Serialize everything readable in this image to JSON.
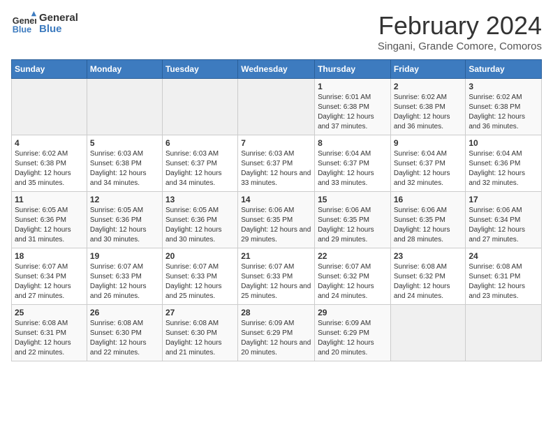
{
  "header": {
    "logo_line1": "General",
    "logo_line2": "Blue",
    "month_title": "February 2024",
    "subtitle": "Singani, Grande Comore, Comoros"
  },
  "days_of_week": [
    "Sunday",
    "Monday",
    "Tuesday",
    "Wednesday",
    "Thursday",
    "Friday",
    "Saturday"
  ],
  "weeks": [
    [
      {
        "day": "",
        "info": ""
      },
      {
        "day": "",
        "info": ""
      },
      {
        "day": "",
        "info": ""
      },
      {
        "day": "",
        "info": ""
      },
      {
        "day": "1",
        "info": "Sunrise: 6:01 AM\nSunset: 6:38 PM\nDaylight: 12 hours and 37 minutes."
      },
      {
        "day": "2",
        "info": "Sunrise: 6:02 AM\nSunset: 6:38 PM\nDaylight: 12 hours and 36 minutes."
      },
      {
        "day": "3",
        "info": "Sunrise: 6:02 AM\nSunset: 6:38 PM\nDaylight: 12 hours and 36 minutes."
      }
    ],
    [
      {
        "day": "4",
        "info": "Sunrise: 6:02 AM\nSunset: 6:38 PM\nDaylight: 12 hours and 35 minutes."
      },
      {
        "day": "5",
        "info": "Sunrise: 6:03 AM\nSunset: 6:38 PM\nDaylight: 12 hours and 34 minutes."
      },
      {
        "day": "6",
        "info": "Sunrise: 6:03 AM\nSunset: 6:37 PM\nDaylight: 12 hours and 34 minutes."
      },
      {
        "day": "7",
        "info": "Sunrise: 6:03 AM\nSunset: 6:37 PM\nDaylight: 12 hours and 33 minutes."
      },
      {
        "day": "8",
        "info": "Sunrise: 6:04 AM\nSunset: 6:37 PM\nDaylight: 12 hours and 33 minutes."
      },
      {
        "day": "9",
        "info": "Sunrise: 6:04 AM\nSunset: 6:37 PM\nDaylight: 12 hours and 32 minutes."
      },
      {
        "day": "10",
        "info": "Sunrise: 6:04 AM\nSunset: 6:36 PM\nDaylight: 12 hours and 32 minutes."
      }
    ],
    [
      {
        "day": "11",
        "info": "Sunrise: 6:05 AM\nSunset: 6:36 PM\nDaylight: 12 hours and 31 minutes."
      },
      {
        "day": "12",
        "info": "Sunrise: 6:05 AM\nSunset: 6:36 PM\nDaylight: 12 hours and 30 minutes."
      },
      {
        "day": "13",
        "info": "Sunrise: 6:05 AM\nSunset: 6:36 PM\nDaylight: 12 hours and 30 minutes."
      },
      {
        "day": "14",
        "info": "Sunrise: 6:06 AM\nSunset: 6:35 PM\nDaylight: 12 hours and 29 minutes."
      },
      {
        "day": "15",
        "info": "Sunrise: 6:06 AM\nSunset: 6:35 PM\nDaylight: 12 hours and 29 minutes."
      },
      {
        "day": "16",
        "info": "Sunrise: 6:06 AM\nSunset: 6:35 PM\nDaylight: 12 hours and 28 minutes."
      },
      {
        "day": "17",
        "info": "Sunrise: 6:06 AM\nSunset: 6:34 PM\nDaylight: 12 hours and 27 minutes."
      }
    ],
    [
      {
        "day": "18",
        "info": "Sunrise: 6:07 AM\nSunset: 6:34 PM\nDaylight: 12 hours and 27 minutes."
      },
      {
        "day": "19",
        "info": "Sunrise: 6:07 AM\nSunset: 6:33 PM\nDaylight: 12 hours and 26 minutes."
      },
      {
        "day": "20",
        "info": "Sunrise: 6:07 AM\nSunset: 6:33 PM\nDaylight: 12 hours and 25 minutes."
      },
      {
        "day": "21",
        "info": "Sunrise: 6:07 AM\nSunset: 6:33 PM\nDaylight: 12 hours and 25 minutes."
      },
      {
        "day": "22",
        "info": "Sunrise: 6:07 AM\nSunset: 6:32 PM\nDaylight: 12 hours and 24 minutes."
      },
      {
        "day": "23",
        "info": "Sunrise: 6:08 AM\nSunset: 6:32 PM\nDaylight: 12 hours and 24 minutes."
      },
      {
        "day": "24",
        "info": "Sunrise: 6:08 AM\nSunset: 6:31 PM\nDaylight: 12 hours and 23 minutes."
      }
    ],
    [
      {
        "day": "25",
        "info": "Sunrise: 6:08 AM\nSunset: 6:31 PM\nDaylight: 12 hours and 22 minutes."
      },
      {
        "day": "26",
        "info": "Sunrise: 6:08 AM\nSunset: 6:30 PM\nDaylight: 12 hours and 22 minutes."
      },
      {
        "day": "27",
        "info": "Sunrise: 6:08 AM\nSunset: 6:30 PM\nDaylight: 12 hours and 21 minutes."
      },
      {
        "day": "28",
        "info": "Sunrise: 6:09 AM\nSunset: 6:29 PM\nDaylight: 12 hours and 20 minutes."
      },
      {
        "day": "29",
        "info": "Sunrise: 6:09 AM\nSunset: 6:29 PM\nDaylight: 12 hours and 20 minutes."
      },
      {
        "day": "",
        "info": ""
      },
      {
        "day": "",
        "info": ""
      }
    ]
  ]
}
